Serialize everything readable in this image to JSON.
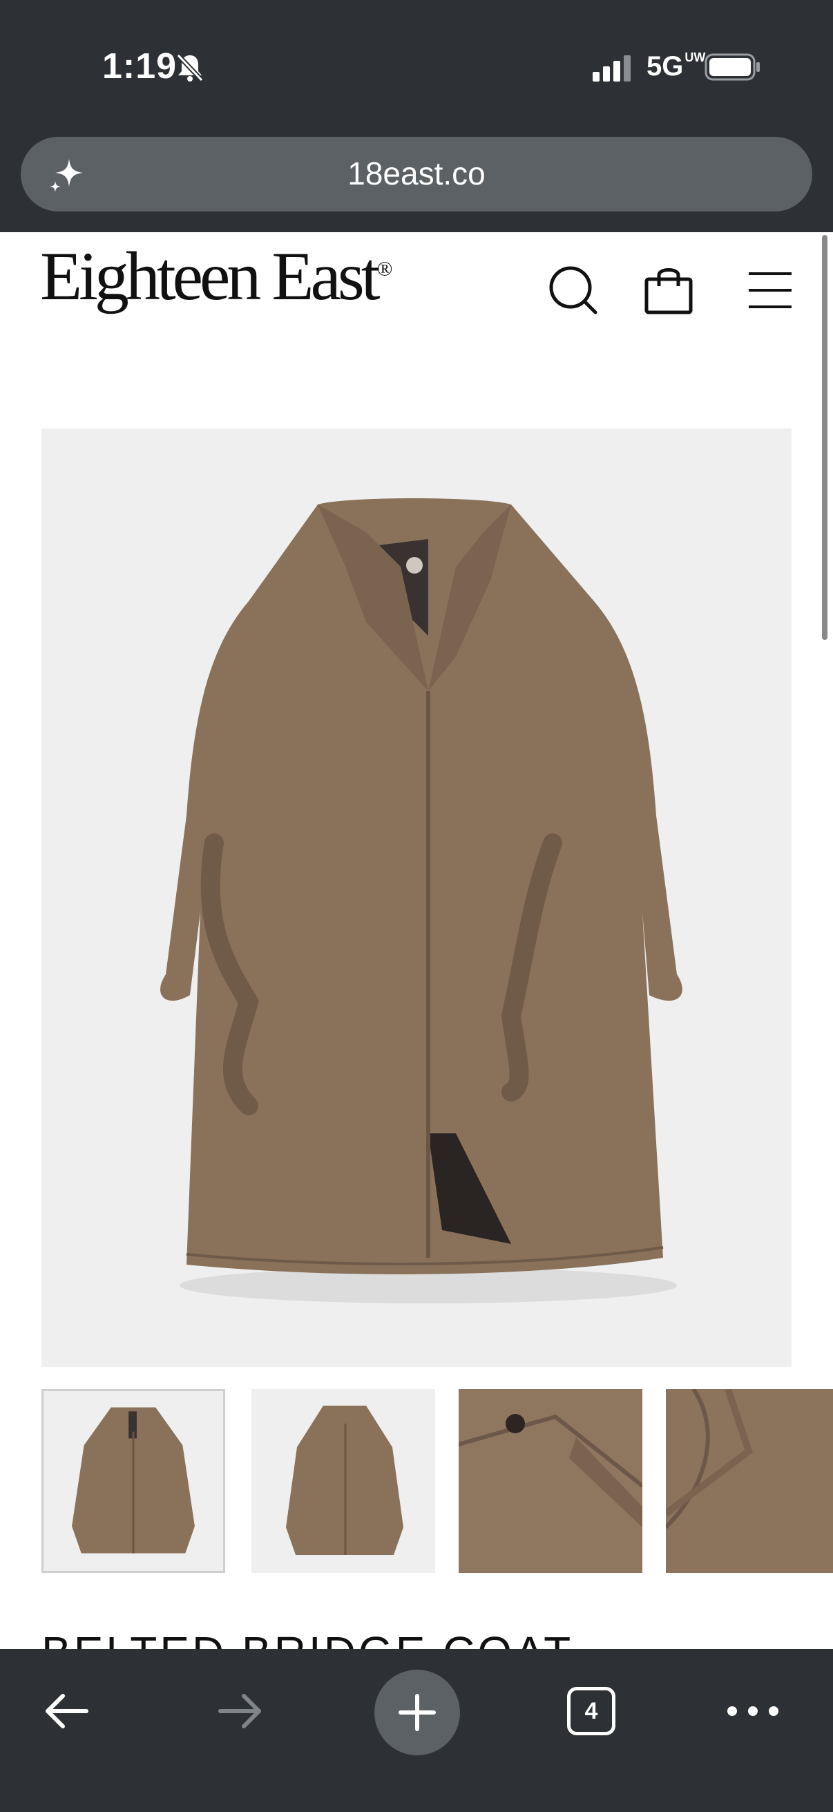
{
  "status_bar": {
    "time": "1:19",
    "network": "5G",
    "network_sup": "UW"
  },
  "browser": {
    "url": "18east.co",
    "tab_count": "4",
    "icons": [
      "sparkle-icon",
      "back-arrow-icon",
      "forward-arrow-icon",
      "new-tab-icon",
      "tabs-icon",
      "more-icon"
    ]
  },
  "site": {
    "logo": "Eighteen East",
    "logo_mark": "®",
    "header_icons": [
      "search-icon",
      "shopping-bag-icon",
      "hamburger-menu-icon"
    ]
  },
  "product": {
    "title": "BELTED BRIDGE COAT",
    "gallery": [
      {
        "view": "front"
      },
      {
        "view": "front-angle"
      },
      {
        "view": "collar-detail"
      },
      {
        "view": "lapel-detail"
      }
    ]
  },
  "colors": {
    "chrome": "#2d3034",
    "url_bar": "#5c6166",
    "coat": "#8a725a",
    "image_bg": "#efefef"
  }
}
